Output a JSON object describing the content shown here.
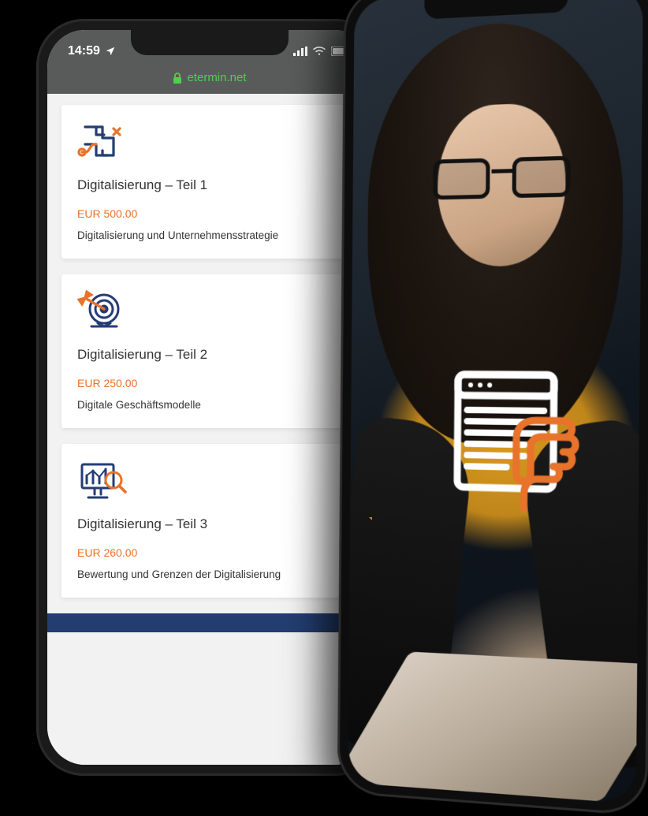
{
  "status": {
    "time": "14:59",
    "location_icon": "location-arrow",
    "signal_icon": "cell-signal",
    "wifi_icon": "wifi",
    "battery_icon": "battery"
  },
  "browser": {
    "lock_icon": "lock-icon",
    "url": "etermin.net"
  },
  "cards": [
    {
      "icon": "maze-path-icon",
      "title": "Digitalisierung – Teil 1",
      "price": "EUR 500.00",
      "desc": "Digitalisierung und Unternehmensstrategie"
    },
    {
      "icon": "target-dart-icon",
      "title": "Digitalisierung – Teil 2",
      "price": "EUR 250.00",
      "desc": "Digitale Geschäftsmodelle"
    },
    {
      "icon": "chart-magnifier-icon",
      "title": "Digitalisierung – Teil 3",
      "price": "EUR 260.00",
      "desc": "Bewertung und Grenzen der Digitalisierung"
    }
  ],
  "colors": {
    "accent": "#e8732b",
    "brand_nav": "#233d71",
    "url_green": "#4ad24a"
  },
  "right_phone": {
    "overlay_icon": "document-hand-icon"
  }
}
